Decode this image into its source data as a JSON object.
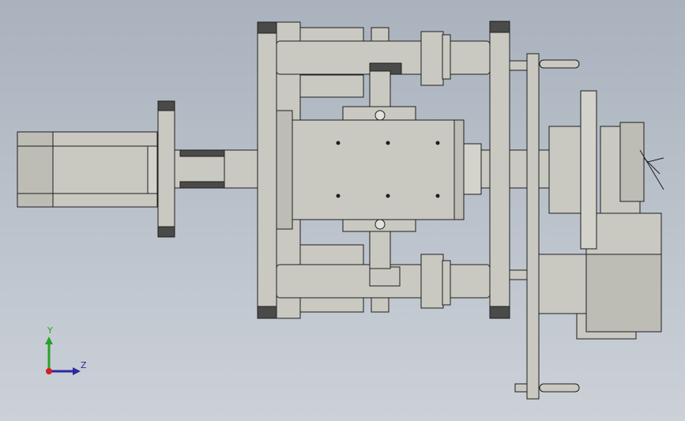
{
  "viewport": {
    "background_top": "#a9b2bd",
    "background_bottom": "#ccd1d8"
  },
  "triad": {
    "y_label": "Y",
    "z_label": "Z",
    "y_color": "#2aa02a",
    "z_color": "#2a2aa0",
    "origin_color": "#d02020"
  },
  "model": {
    "part_color": "#c9c9c1",
    "edge_color": "#1e1e1e",
    "dark_color": "#4a4a48"
  }
}
